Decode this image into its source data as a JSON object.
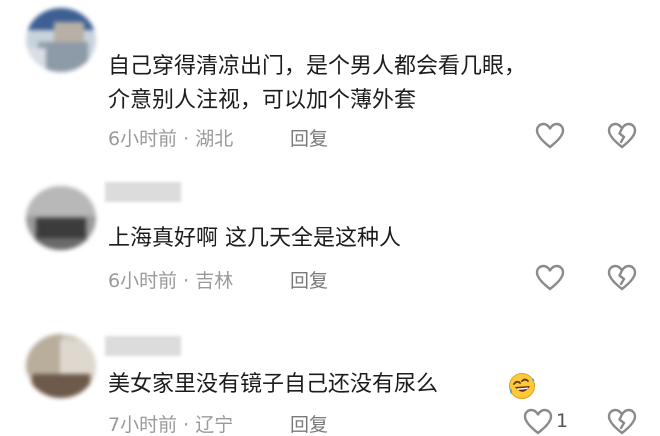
{
  "comments": [
    {
      "text_line1": "自己穿得清凉出门，是个男人都会看几眼，",
      "text_line2": "介意别人注视，可以加个薄外套",
      "time": "6小时前",
      "location": "湖北",
      "reply_label": "回复",
      "like_count": ""
    },
    {
      "text_line1": "上海真好啊 这几天全是这种人",
      "time": "6小时前",
      "location": "吉林",
      "reply_label": "回复",
      "like_count": ""
    },
    {
      "text_line1": "美女家里没有镜子自己还没有尿么",
      "time": "7小时前",
      "location": "辽宁",
      "reply_label": "回复",
      "like_count": "1"
    }
  ],
  "separator": " · ",
  "icons": {
    "like": "heart-outline-icon",
    "dislike": "broken-heart-outline-icon",
    "emoji": "rofl-emoji-icon"
  },
  "colors": {
    "text": "#1c1c1c",
    "meta": "#9a9a9a",
    "icon": "#8a8a8a"
  }
}
